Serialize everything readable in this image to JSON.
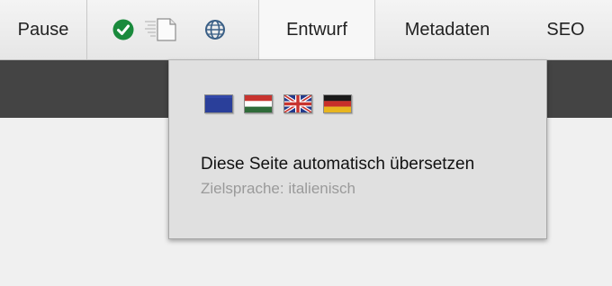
{
  "toolbar": {
    "pause_label": "Pause",
    "tabs": [
      {
        "label": "Entwurf",
        "active": true
      },
      {
        "label": "Metadaten",
        "active": false
      },
      {
        "label": "SEO",
        "active": false
      }
    ],
    "icons": [
      "check-icon",
      "document-icon",
      "globe-icon"
    ]
  },
  "dropdown": {
    "flags": [
      "eu-flag-icon",
      "hungary-flag-icon",
      "uk-flag-icon",
      "germany-flag-icon"
    ],
    "translate_label": "Diese Seite automatisch übersetzen",
    "target_language": "Zielsprache: italienisch"
  },
  "colors": {
    "toolbar_bg": "#e9e9e9",
    "dark_bar": "#444444",
    "dropdown_bg": "#e0e0e0",
    "check_green": "#1a8a3c",
    "muted_text": "#9a9a9a"
  }
}
